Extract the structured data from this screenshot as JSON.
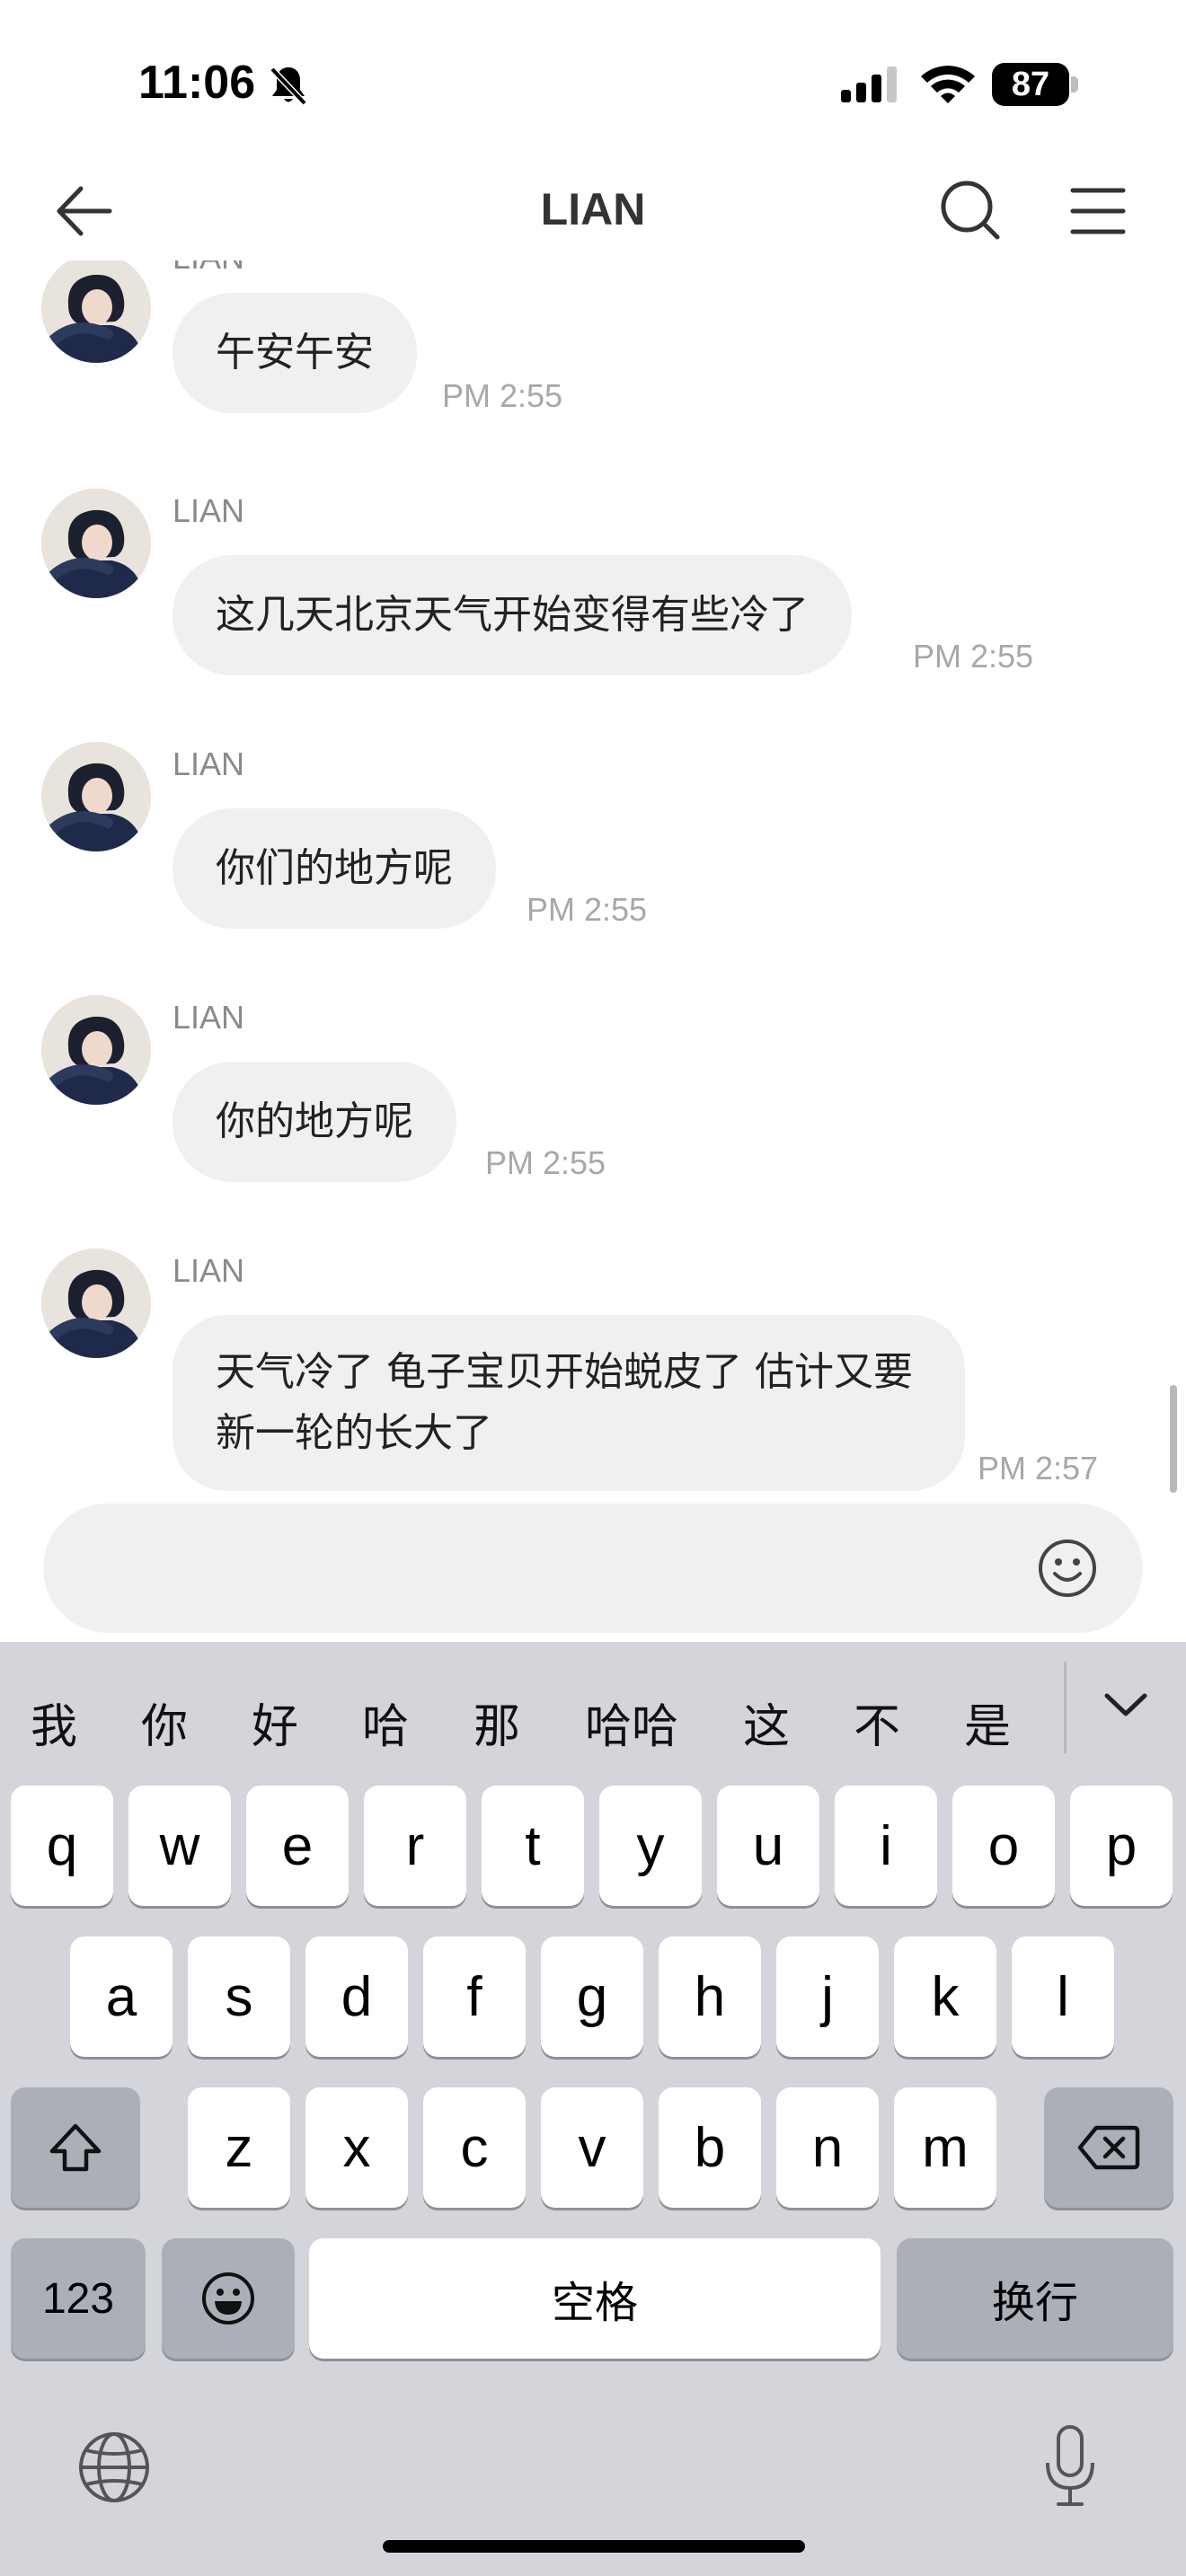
{
  "status_bar": {
    "time": "11:06",
    "battery": "87",
    "icons": [
      "bell-slash-icon",
      "cellular-signal-icon",
      "wifi-icon",
      "battery-icon"
    ]
  },
  "nav": {
    "title": "LIAN",
    "icons": [
      "back-arrow-icon",
      "search-icon",
      "menu-icon"
    ]
  },
  "messages": [
    {
      "sender": "LIAN",
      "text": "午安午安",
      "time": "PM 2:55"
    },
    {
      "sender": "LIAN",
      "text": "这几天北京天气开始变得有些冷了",
      "time": "PM 2:55"
    },
    {
      "sender": "LIAN",
      "text": "你们的地方呢",
      "time": "PM 2:55"
    },
    {
      "sender": "LIAN",
      "text": "你的地方呢",
      "time": "PM 2:55"
    },
    {
      "sender": "LIAN",
      "text": "天气冷了 龟子宝贝开始蜕皮了 估计又要新一轮的长大了",
      "time": "PM 2:57"
    }
  ],
  "input": {
    "value": "",
    "icons": [
      "smiley-icon"
    ]
  },
  "keyboard": {
    "candidates": [
      "我",
      "你",
      "好",
      "哈",
      "那",
      "哈哈",
      "这",
      "不",
      "是"
    ],
    "row1": [
      "q",
      "w",
      "e",
      "r",
      "t",
      "y",
      "u",
      "i",
      "o",
      "p"
    ],
    "row2": [
      "a",
      "s",
      "d",
      "f",
      "g",
      "h",
      "j",
      "k",
      "l"
    ],
    "row3": [
      "z",
      "x",
      "c",
      "v",
      "b",
      "n",
      "m"
    ],
    "numbers_label": "123",
    "space_label": "空格",
    "return_label": "换行",
    "icons": [
      "chevron-down-icon",
      "shift-icon",
      "delete-icon",
      "emoji-key-icon",
      "globe-icon",
      "microphone-icon"
    ]
  }
}
